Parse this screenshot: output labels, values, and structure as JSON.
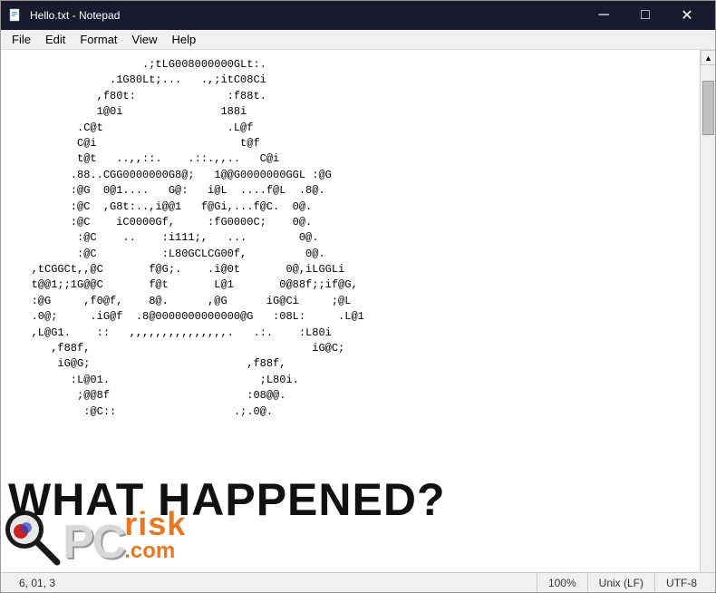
{
  "window": {
    "title": "Hello.txt - Notepad",
    "icon": "📄"
  },
  "title_bar": {
    "minimize_label": "─",
    "maximize_label": "□",
    "close_label": "✕"
  },
  "menu": {
    "items": [
      {
        "id": "file",
        "label": "File"
      },
      {
        "id": "edit",
        "label": "Edit"
      },
      {
        "id": "format",
        "label": "Format"
      },
      {
        "id": "view",
        "label": "View"
      },
      {
        "id": "help",
        "label": "Help"
      }
    ]
  },
  "editor": {
    "content": "                    .;tLG008000000GLt:.\n               .1G80Lt;...   .,;itC08Ci\n             ,f80t:              :f88t.\n             1@0i               188i\n          .C@t                   .L@f\n          C@i                      t@f\n          t@t   ..,,::.    .::.,,..   C@i\n         .88..CGG0000000G8@;   1@@G0000000GGL :@G\n         :@G  0@1....   G@:   i@L  ....f@L  .8@.\n         :@C  ,G8t:..,i@@1   f@Gi,...f@C.  0@.\n         :@C    iC0000Gf,     :fG0000C;    0@.\n          :@C    ..    :i111;,   ...        0@.\n          :@C          :L80GCLCG00f,         0@.\n   ,tCGGCt,,@C       f@G;.    .i@0t       0@,iLGGLi\n   t@@1;;1G@@C       f@t       L@1       0@88f;;if@G,\n   :@G     ,f0@f,    8@.      ,@G      iG@Ci     ;@L\n   .0@;     .iG@f  .8@0000000000000@G   :08L:     .L@1\n   ,L@G1.    ::   ,,,,,,,,,,,,,,,.   .:.    :L80i\n      ,f88f,                                  iG@C;\n       iG@G;                        ,f88f,\n         :L@01.                       ;L80i.\n          ;@@8f                     :08@@.\n           :@C::                  .;.0@.\n\n\n",
    "watermark_text": "WHAT HAPPENED?"
  },
  "status_bar": {
    "cursor": "6, 01, 3",
    "zoom": "100%",
    "line_ending": "Unix (LF)",
    "encoding": "UTF-8"
  },
  "watermark": {
    "what_happened": "WHAT HAPPENED?",
    "pc_text": "PC",
    "risk_text": "risk",
    "com_text": ".com"
  }
}
